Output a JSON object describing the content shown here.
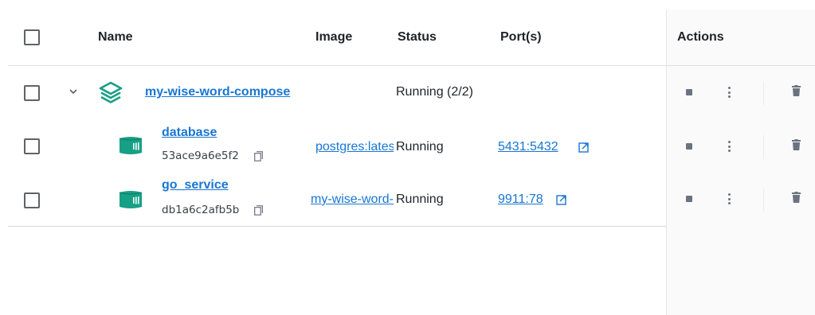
{
  "columns": {
    "name": "Name",
    "image": "Image",
    "status": "Status",
    "ports": "Port(s)",
    "actions": "Actions"
  },
  "colors": {
    "accent": "#1976d2",
    "icon_teal": "#16a085"
  },
  "rows": [
    {
      "type": "compose",
      "name": "my-wise-word-compose",
      "status": "Running (2/2)",
      "icon": "layers-icon"
    },
    {
      "type": "container",
      "name": "database",
      "id": "53ace9a6e5f2",
      "image": "postgres:latest",
      "status": "Running",
      "port": "5431:5432",
      "icon": "container-icon"
    },
    {
      "type": "container",
      "name": "go_service",
      "id": "db1a6c2afb5b",
      "image": "my-wise-word-compose-go_service",
      "status": "Running",
      "port": "9911:78",
      "icon": "container-icon"
    }
  ]
}
